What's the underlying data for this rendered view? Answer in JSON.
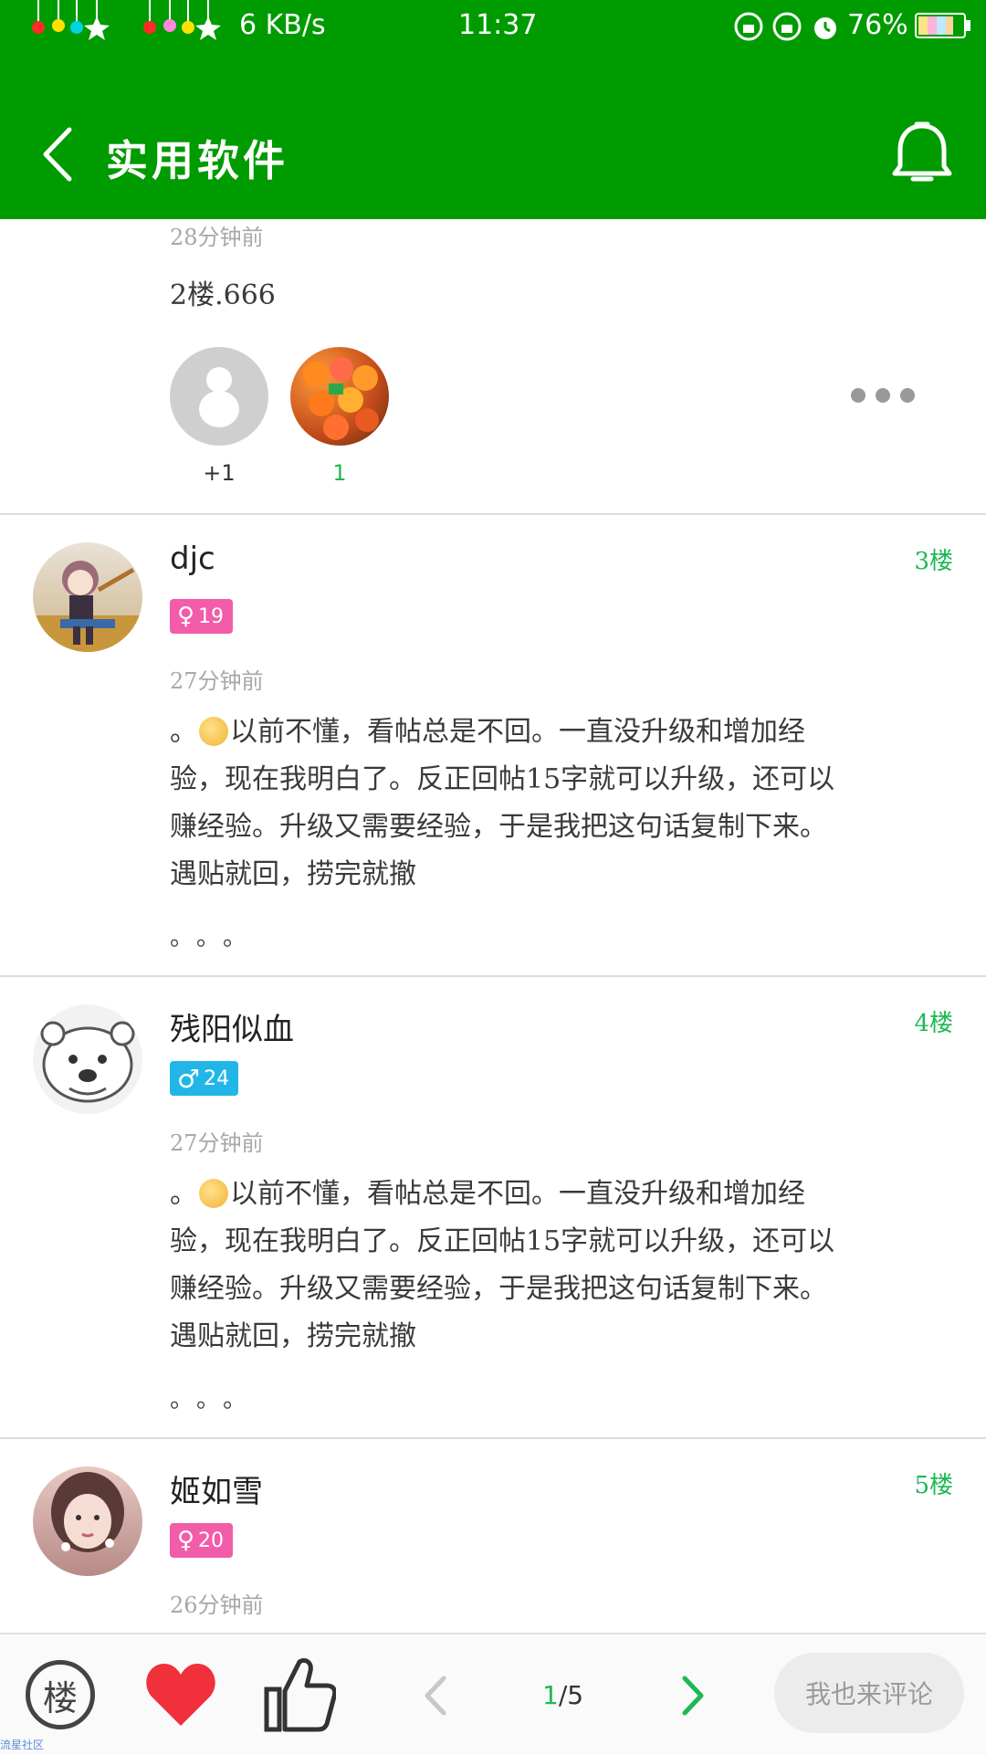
{
  "status_bar": {
    "network_speed": "6 KB/s",
    "time": "11:37",
    "battery": "76%"
  },
  "header": {
    "title": "实用软件"
  },
  "post2": {
    "time": "28分钟前",
    "text": "2楼.666",
    "likes": [
      {
        "label": "+1",
        "color": "#333333"
      },
      {
        "label": "1",
        "color": "#1db954"
      }
    ]
  },
  "comments": [
    {
      "username": "djc",
      "gender_symbol": "♀",
      "level": "19",
      "floor": "3楼",
      "time": "27分钟前",
      "text_prefix": "。",
      "text_line1": "以前不懂，看帖总是不回。一直没升级和增加经",
      "text_line2": "验，现在我明白了。反正回帖15字就可以升级，还可以",
      "text_line3": "赚经验。升级又需要经验，于是我把这句话复制下来。",
      "text_line4": "遇贴就回，捞完就撤",
      "tail": "。。。"
    },
    {
      "username": "残阳似血",
      "gender_symbol": "♂",
      "level": "24",
      "floor": "4楼",
      "time": "27分钟前",
      "text_prefix": "。",
      "text_line1": "以前不懂，看帖总是不回。一直没升级和增加经",
      "text_line2": "验，现在我明白了。反正回帖15字就可以升级，还可以",
      "text_line3": "赚经验。升级又需要经验，于是我把这句话复制下来。",
      "text_line4": "遇贴就回，捞完就撤",
      "tail": "。。。"
    },
    {
      "username": "姬如雪",
      "gender_symbol": "♀",
      "level": "20",
      "floor": "5楼",
      "time": "26分钟前"
    }
  ],
  "bottom_bar": {
    "floor_icon_label": "楼",
    "page_current": "1",
    "page_total": "/5",
    "comment_button": "我也来评论"
  },
  "watermark": "流星社区",
  "colors": {
    "brand_green": "#009b00",
    "accent_green": "#1db954",
    "female_badge": "#f25ca8",
    "male_badge": "#22b6e8",
    "heart_red": "#f0303a"
  }
}
